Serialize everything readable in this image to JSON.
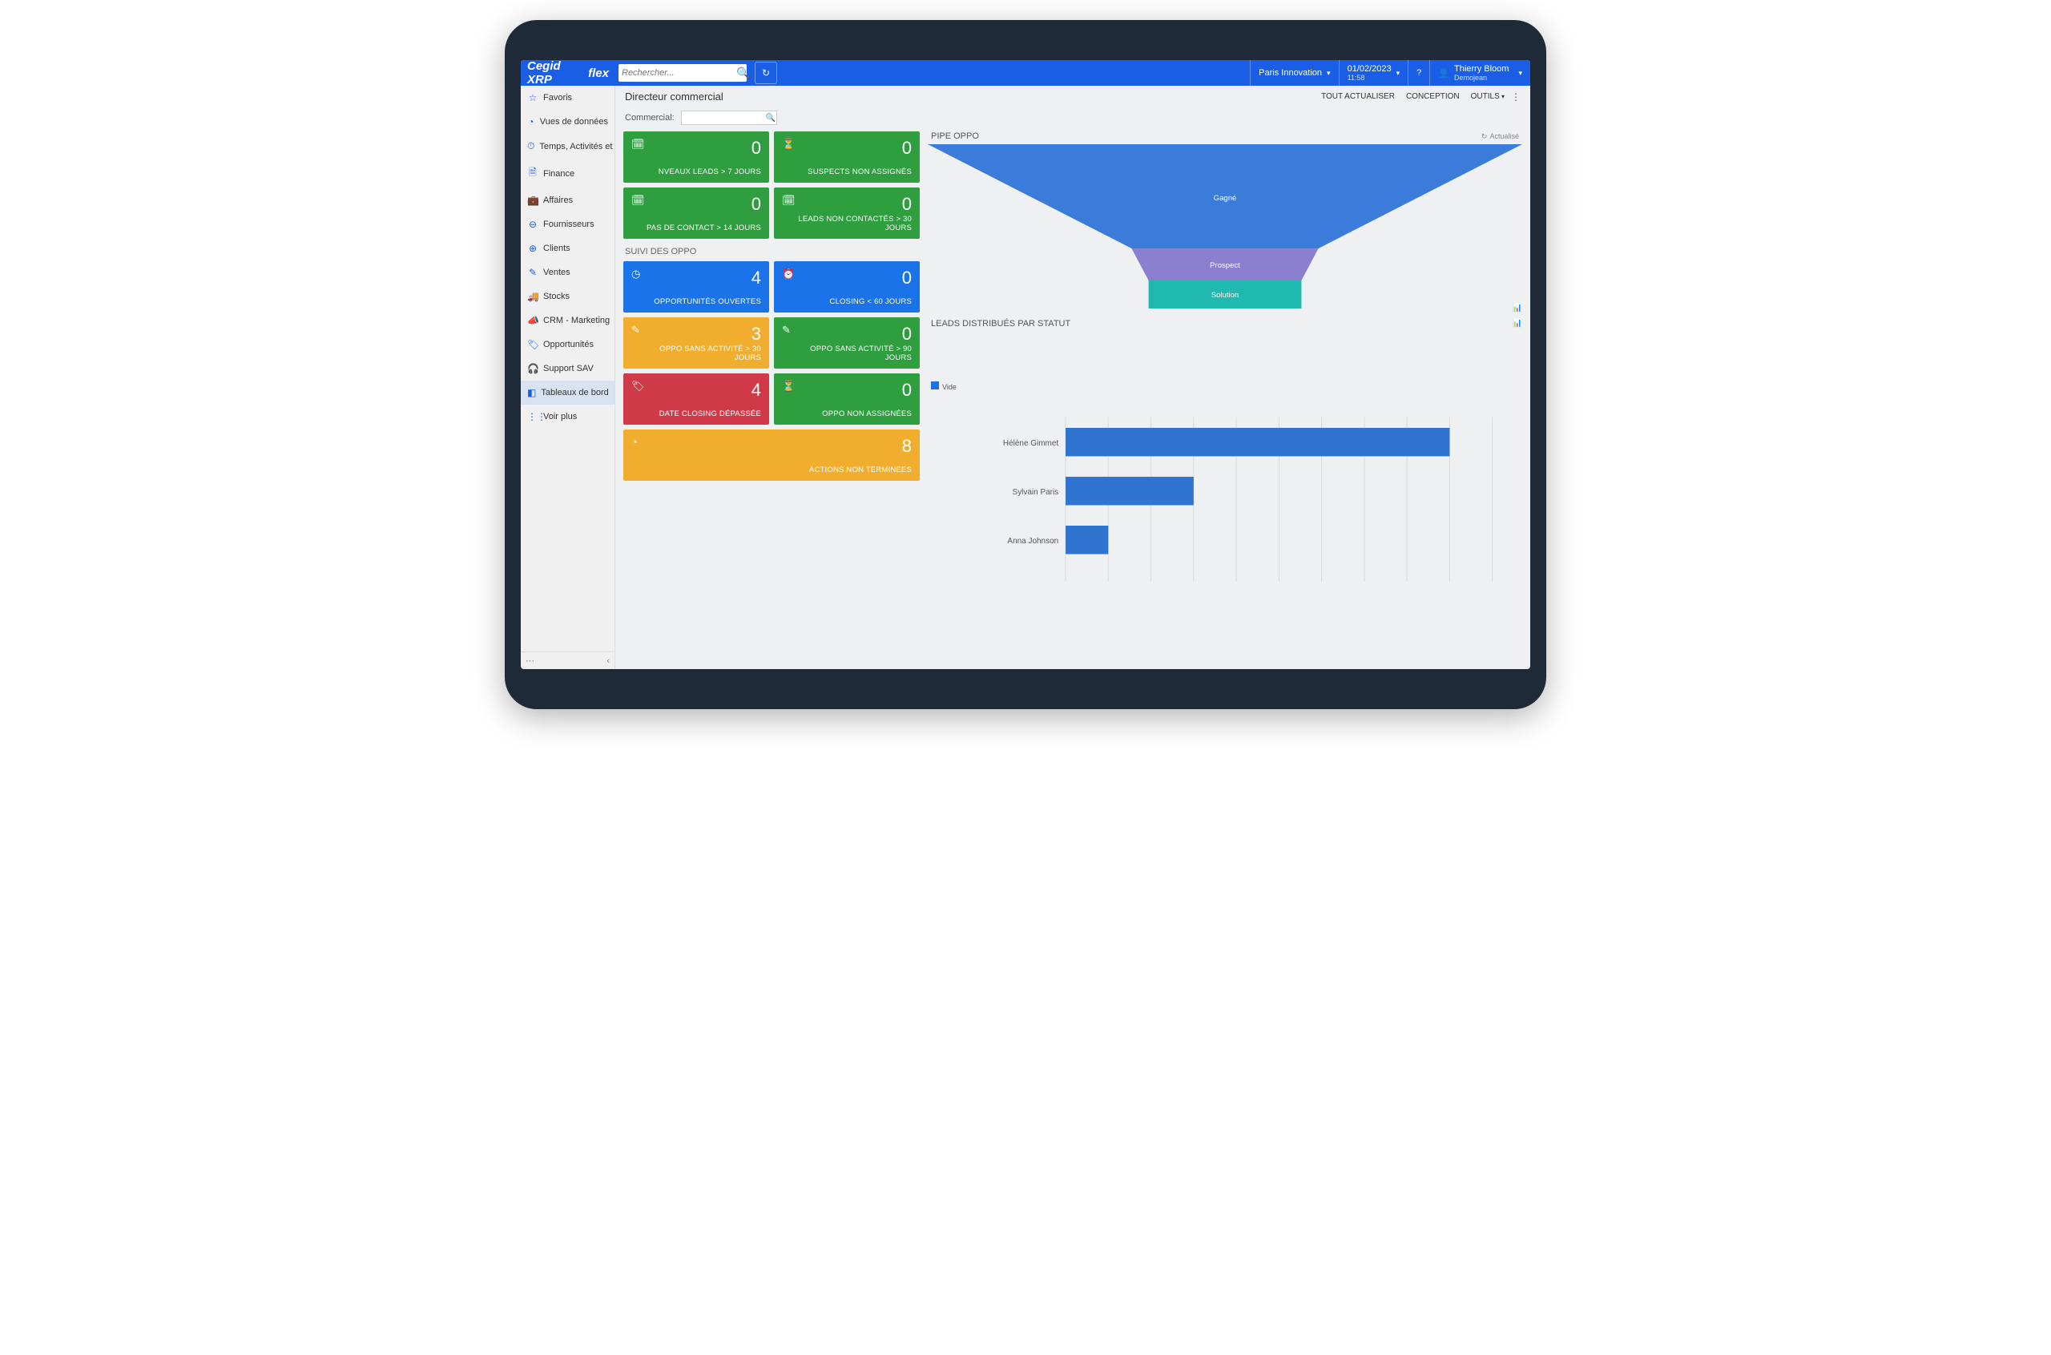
{
  "logo": {
    "brand": "Cegid XRP",
    "suffix": "flex"
  },
  "search": {
    "placeholder": "Rechercher..."
  },
  "top": {
    "org": "Paris Innovation",
    "date": "01/02/2023",
    "time": "11:58",
    "user_name": "Thierry Bloom",
    "user_sub": "Demojean"
  },
  "sidebar": {
    "items": [
      {
        "icon": "☆",
        "label": "Favoris"
      },
      {
        "icon": "◔",
        "label": "Vues de données"
      },
      {
        "icon": "⏱",
        "label": "Temps, Activités et ..."
      },
      {
        "icon": "🗎",
        "label": "Finance"
      },
      {
        "icon": "💼",
        "label": "Affaires"
      },
      {
        "icon": "⊖",
        "label": "Fournisseurs"
      },
      {
        "icon": "⊕",
        "label": "Clients"
      },
      {
        "icon": "✎",
        "label": "Ventes"
      },
      {
        "icon": "🚚",
        "label": "Stocks"
      },
      {
        "icon": "📣",
        "label": "CRM - Marketing"
      },
      {
        "icon": "🏷",
        "label": "Opportunités"
      },
      {
        "icon": "🎧",
        "label": "Support SAV"
      },
      {
        "icon": "◧",
        "label": "Tableaux de bord"
      },
      {
        "icon": "⋮⋮",
        "label": "Voir plus"
      }
    ],
    "active_index": 12
  },
  "page": {
    "title": "Directeur commercial",
    "actions": {
      "refresh": "TOUT ACTUALISER",
      "design": "CONCEPTION",
      "tools": "OUTILS"
    },
    "filter_label": "Commercial:"
  },
  "tiles": {
    "row1": [
      {
        "icon": "🗓",
        "value": "0",
        "label": "NVEAUX LEADS > 7 JOURS",
        "color": "c-green"
      },
      {
        "icon": "⏳",
        "value": "0",
        "label": "SUSPECTS NON ASSIGNÉS",
        "color": "c-green"
      }
    ],
    "row2": [
      {
        "icon": "🗓",
        "value": "0",
        "label": "PAS DE CONTACT > 14 JOURS",
        "color": "c-green"
      },
      {
        "icon": "🗓",
        "value": "0",
        "label": "LEADS NON CONTACTÉS > 30 JOURS",
        "color": "c-green"
      }
    ],
    "section2": "SUIVI DES OPPO",
    "row3": [
      {
        "icon": "◷",
        "value": "4",
        "label": "OPPORTUNITÉS OUVERTES",
        "color": "c-blue"
      },
      {
        "icon": "⏰",
        "value": "0",
        "label": "CLOSING < 60 JOURS",
        "color": "c-blue"
      }
    ],
    "row4": [
      {
        "icon": "✎",
        "value": "3",
        "label": "OPPO SANS ACTIVITÉ > 30 JOURS",
        "color": "c-yellow"
      },
      {
        "icon": "✎",
        "value": "0",
        "label": "OPPO SANS ACTIVITÉ > 90 JOURS",
        "color": "c-green"
      }
    ],
    "row5": [
      {
        "icon": "🏷",
        "value": "4",
        "label": "DATE CLOSING DÉPASSÉE",
        "color": "c-red"
      },
      {
        "icon": "⏳",
        "value": "0",
        "label": "OPPO NON ASSIGNÉES",
        "color": "c-green"
      }
    ],
    "row6": [
      {
        "icon": "◔",
        "value": "8",
        "label": "ACTIONS NON TERMINEES",
        "color": "c-yellow"
      }
    ]
  },
  "pipe": {
    "title": "PIPE OPPO",
    "updated": "Actualisé",
    "stages": [
      {
        "label": "Gagné",
        "color": "#3b7bd9"
      },
      {
        "label": "Prospect",
        "color": "#8b7fd0"
      },
      {
        "label": "Solution",
        "color": "#1fb9b0"
      }
    ]
  },
  "leads": {
    "title": "LEADS DISTRIBUÉS PAR STATUT",
    "legend": "Vide"
  },
  "chart_data": {
    "type": "bar",
    "orientation": "horizontal",
    "categories": [
      "Hélène Gimmet",
      "Sylvain Paris",
      "Anna Johnson"
    ],
    "values": [
      9,
      3,
      1
    ],
    "xlim": [
      0,
      10
    ],
    "series_name": "Vide",
    "color": "#2f74d0"
  }
}
